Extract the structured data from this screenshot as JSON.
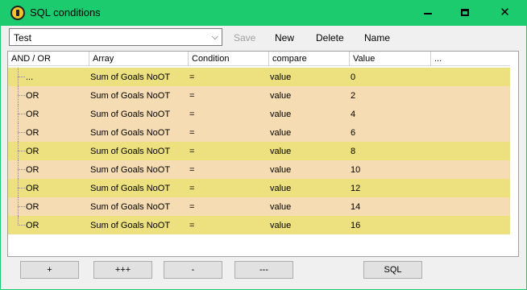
{
  "window": {
    "title": "SQL conditions",
    "icon": "app-icon",
    "controls": {
      "minimize": "minimize-icon",
      "maximize": "maximize-icon",
      "close": "close-icon"
    }
  },
  "toolbar": {
    "combo_value": "Test",
    "save_label": "Save",
    "new_label": "New",
    "delete_label": "Delete",
    "name_label": "Name"
  },
  "grid": {
    "headers": [
      "AND / OR",
      "Array",
      "Condition",
      "compare",
      "Value",
      "..."
    ],
    "rows": [
      {
        "andor": "...",
        "array": "Sum of Goals NoOT",
        "condition": "=",
        "compare": "value",
        "value": "0",
        "color": "yellow"
      },
      {
        "andor": "OR",
        "array": "Sum of Goals NoOT",
        "condition": "=",
        "compare": "value",
        "value": "2",
        "color": "peach"
      },
      {
        "andor": "OR",
        "array": "Sum of Goals NoOT",
        "condition": "=",
        "compare": "value",
        "value": "4",
        "color": "peach"
      },
      {
        "andor": "OR",
        "array": "Sum of Goals NoOT",
        "condition": "=",
        "compare": "value",
        "value": "6",
        "color": "peach"
      },
      {
        "andor": "OR",
        "array": "Sum of Goals NoOT",
        "condition": "=",
        "compare": "value",
        "value": "8",
        "color": "yellow"
      },
      {
        "andor": "OR",
        "array": "Sum of Goals NoOT",
        "condition": "=",
        "compare": "value",
        "value": "10",
        "color": "peach"
      },
      {
        "andor": "OR",
        "array": "Sum of Goals NoOT",
        "condition": "=",
        "compare": "value",
        "value": "12",
        "color": "yellow"
      },
      {
        "andor": "OR",
        "array": "Sum of Goals NoOT",
        "condition": "=",
        "compare": "value",
        "value": "14",
        "color": "peach"
      },
      {
        "andor": "OR",
        "array": "Sum of Goals NoOT",
        "condition": "=",
        "compare": "value",
        "value": "16",
        "color": "yellow"
      }
    ]
  },
  "buttons": {
    "add": "+",
    "add_group": "+++",
    "remove": "-",
    "remove_group": "---",
    "sql": "SQL"
  },
  "colors": {
    "titlebar": "#1bcb6d",
    "row_yellow": "#ede17f",
    "row_peach": "#f6dcb2"
  }
}
